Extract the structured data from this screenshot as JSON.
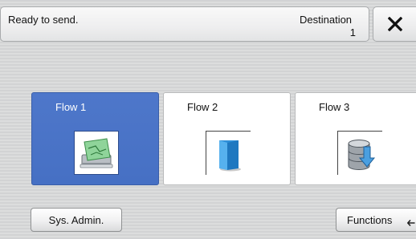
{
  "status": {
    "message": "Ready to send.",
    "destination_label": "Destination",
    "destination_count": "1"
  },
  "close_icon": "close-icon",
  "flows": [
    {
      "label": "Flow 1",
      "icon": "scanner-icon",
      "selected": true
    },
    {
      "label": "Flow 2",
      "icon": "document-icon",
      "selected": false
    },
    {
      "label": "Flow 3",
      "icon": "database-download-icon",
      "selected": false
    }
  ],
  "footer": {
    "sys_admin_label": "Sys. Admin.",
    "functions_label": "Functions",
    "functions_icon": "arrow-left-icon"
  },
  "colors": {
    "selected_tile": "#4e77ca",
    "tile": "#ffffff",
    "background": "#d7d8d9"
  }
}
